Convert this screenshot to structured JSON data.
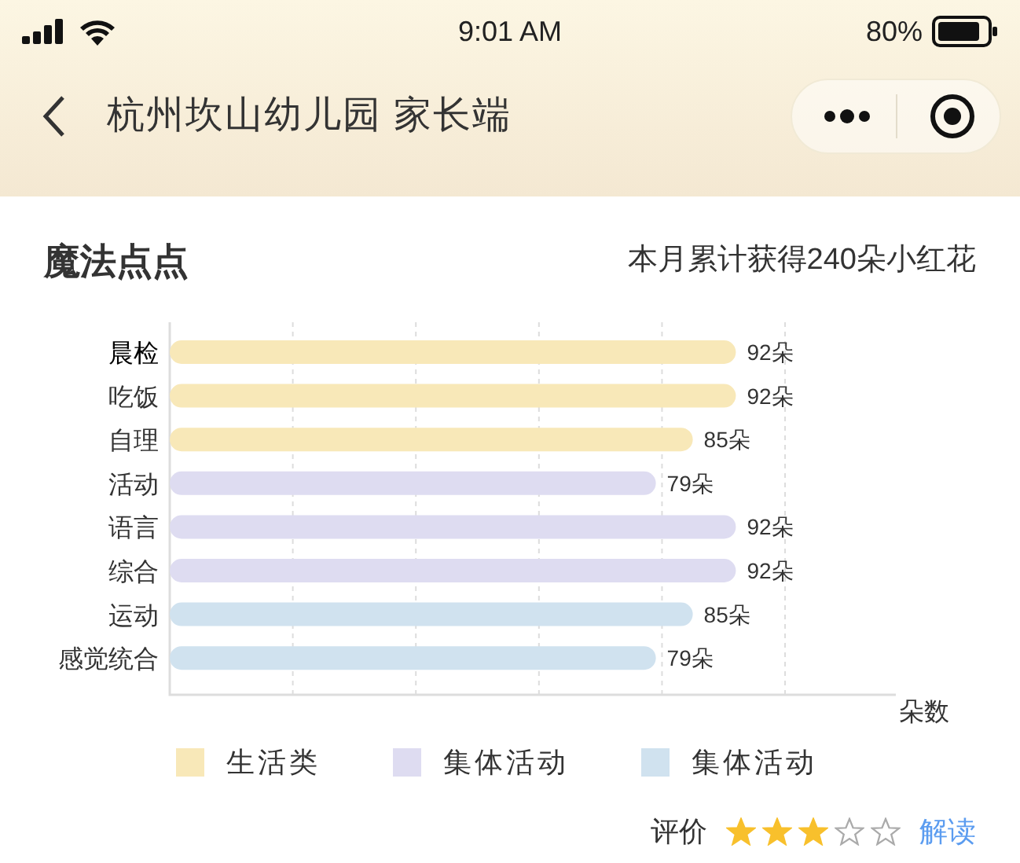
{
  "status_bar": {
    "time": "9:01 AM",
    "battery": "80%"
  },
  "nav": {
    "title": "杭州坎山幼儿园 家长端"
  },
  "card": {
    "title": "魔法点点",
    "summary": "本月累计获得240朵小红花",
    "chart_data": {
      "type": "bar",
      "orientation": "horizontal",
      "annotations": [
        {
          "text": "朵数"
        }
      ],
      "categories": [
        "晨检",
        "吃饭",
        "自理",
        "活动",
        "语言",
        "综合",
        "运动",
        "感觉统合"
      ],
      "series": [
        {
          "name": "生活类",
          "color": "#f8e8b8",
          "values": [
            92,
            92,
            85,
            null,
            null,
            null,
            null,
            null
          ],
          "value_labels": [
            "92朵",
            "92朵",
            "85朵",
            null,
            null,
            null,
            null,
            null
          ]
        },
        {
          "name": "集体活动",
          "color": "#dedcf1",
          "values": [
            null,
            null,
            null,
            79,
            92,
            92,
            null,
            null
          ],
          "value_labels": [
            null,
            null,
            null,
            "79朵",
            "92朵",
            "92朵",
            null,
            null
          ]
        },
        {
          "name": "集体活动",
          "color": "#d0e2ef",
          "values": [
            null,
            null,
            null,
            null,
            null,
            null,
            85,
            79
          ],
          "value_labels": [
            null,
            null,
            null,
            null,
            null,
            null,
            "85朵",
            "79朵"
          ]
        }
      ]
    },
    "rating": {
      "label": "评价",
      "stars": 3,
      "link": "解读"
    }
  }
}
